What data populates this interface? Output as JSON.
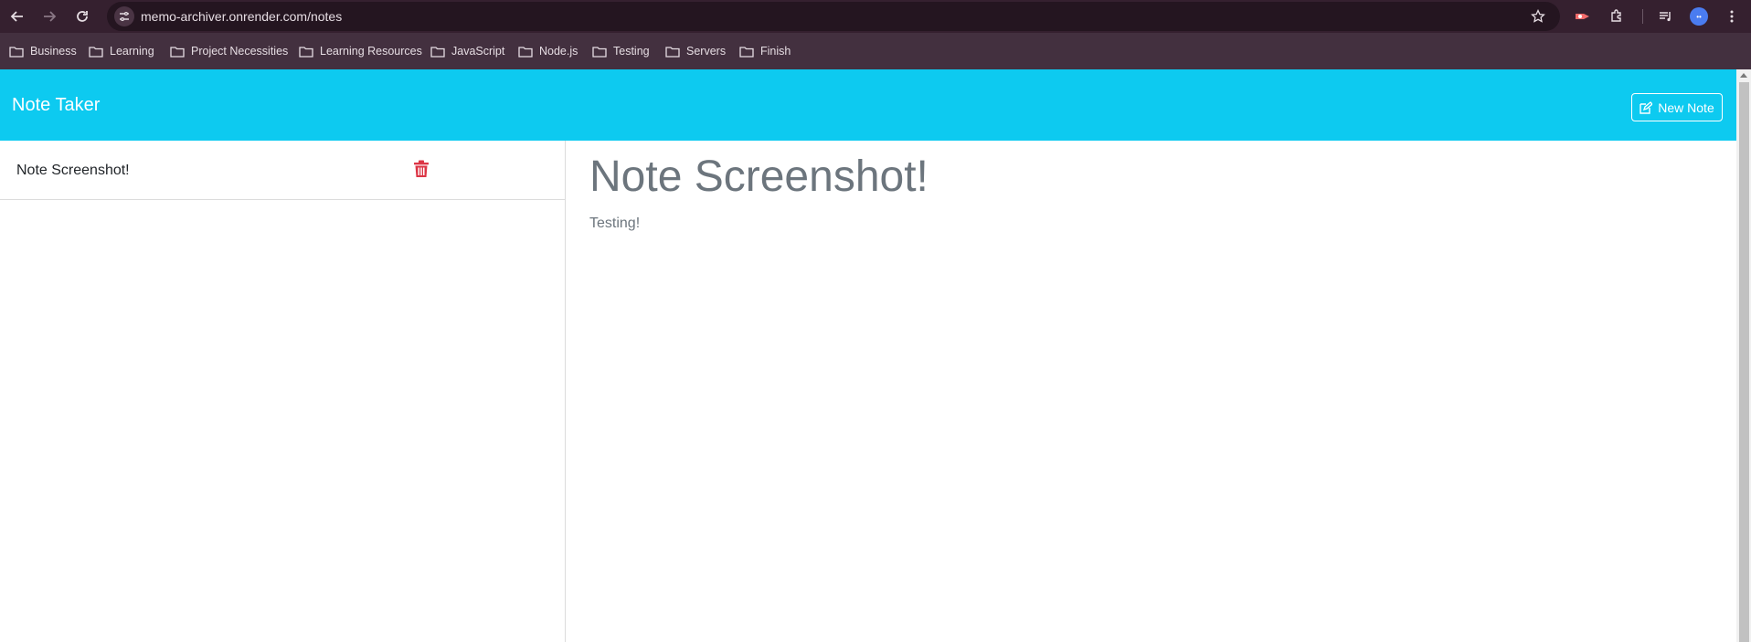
{
  "browser": {
    "url": "memo-archiver.onrender.com/notes",
    "bookmarks": [
      "Business",
      "Learning",
      "Project Necessities",
      "Learning Resources",
      "JavaScript",
      "Node.js",
      "Testing",
      "Servers",
      "Finish"
    ],
    "avatar_text": "••"
  },
  "app": {
    "title": "Note Taker",
    "new_note_label": "New Note",
    "accent_color": "#0dcaf0",
    "delete_color": "#dc3545"
  },
  "notes": [
    {
      "title": "Note Screenshot!"
    }
  ],
  "active_note": {
    "title": "Note Screenshot!",
    "text": "Testing!"
  }
}
